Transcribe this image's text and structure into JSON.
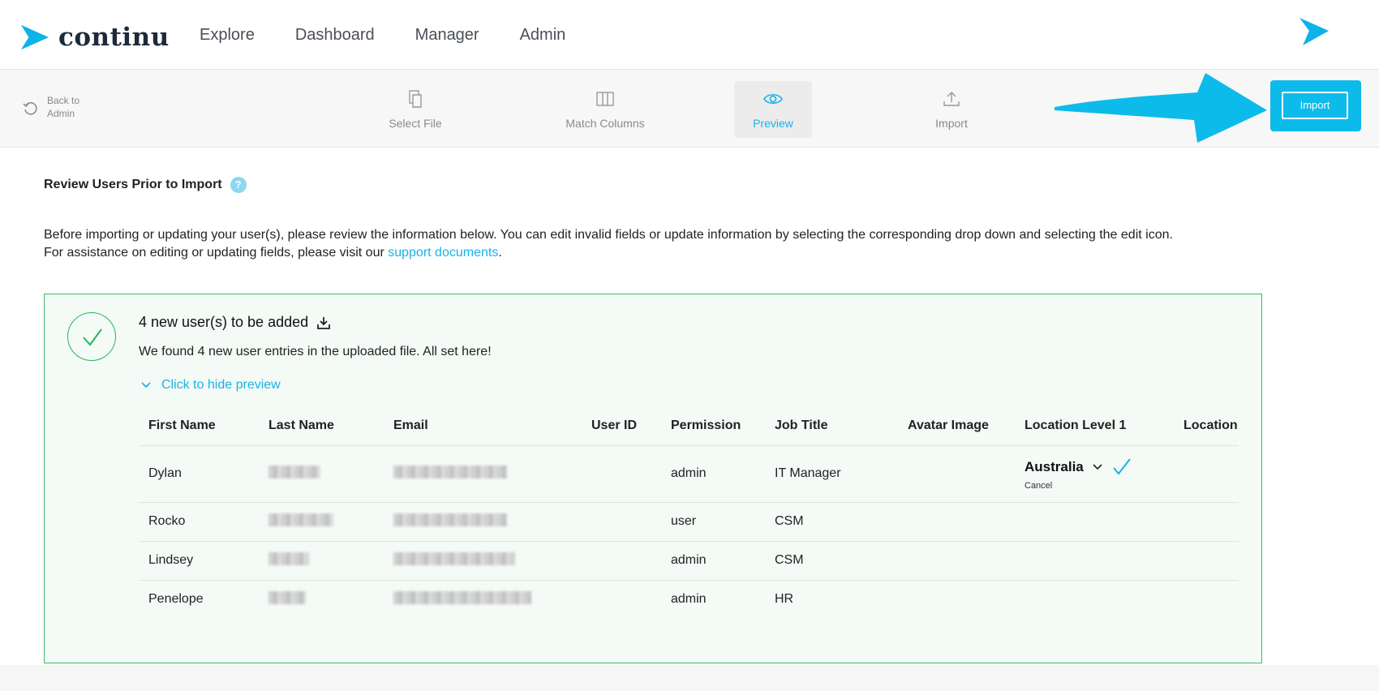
{
  "header": {
    "logo_text": "continu",
    "nav": [
      "Explore",
      "Dashboard",
      "Manager",
      "Admin"
    ]
  },
  "stepper": {
    "back_label": "Back to Admin",
    "steps": [
      {
        "label": "Select File",
        "icon": "file-copy-icon"
      },
      {
        "label": "Match Columns",
        "icon": "columns-icon"
      },
      {
        "label": "Preview",
        "icon": "eye-icon",
        "active": true
      },
      {
        "label": "Import",
        "icon": "upload-icon"
      }
    ],
    "import_button": "Import"
  },
  "content": {
    "title": "Review Users Prior to Import",
    "help": "?",
    "intro_line1": "Before importing or updating your user(s), please review the information below. You can edit invalid fields or update information by selecting the corresponding drop down and selecting the edit icon.",
    "intro_line2_prefix": "For assistance on editing or updating fields, please visit our ",
    "intro_link": "support documents",
    "intro_line2_suffix": "."
  },
  "card": {
    "heading": "4 new user(s) to be added",
    "subtext": "We found 4 new user entries in the uploaded file. All set here!",
    "toggle_label": "Click to hide preview",
    "columns": [
      "First Name",
      "Last Name",
      "Email",
      "User ID",
      "Permission",
      "Job Title",
      "Avatar Image",
      "Location Level 1",
      "Location"
    ],
    "rows": [
      {
        "first": "Dylan",
        "permission": "admin",
        "job": "IT Manager",
        "location1": "Australia",
        "cancel": "Cancel"
      },
      {
        "first": "Rocko",
        "permission": "user",
        "job": "CSM"
      },
      {
        "first": "Lindsey",
        "permission": "admin",
        "job": "CSM"
      },
      {
        "first": "Penelope",
        "permission": "admin",
        "job": "HR"
      }
    ]
  },
  "colors": {
    "accent": "#1ab3e6",
    "success": "#3cb96a",
    "highlight": "#0dbbea"
  }
}
